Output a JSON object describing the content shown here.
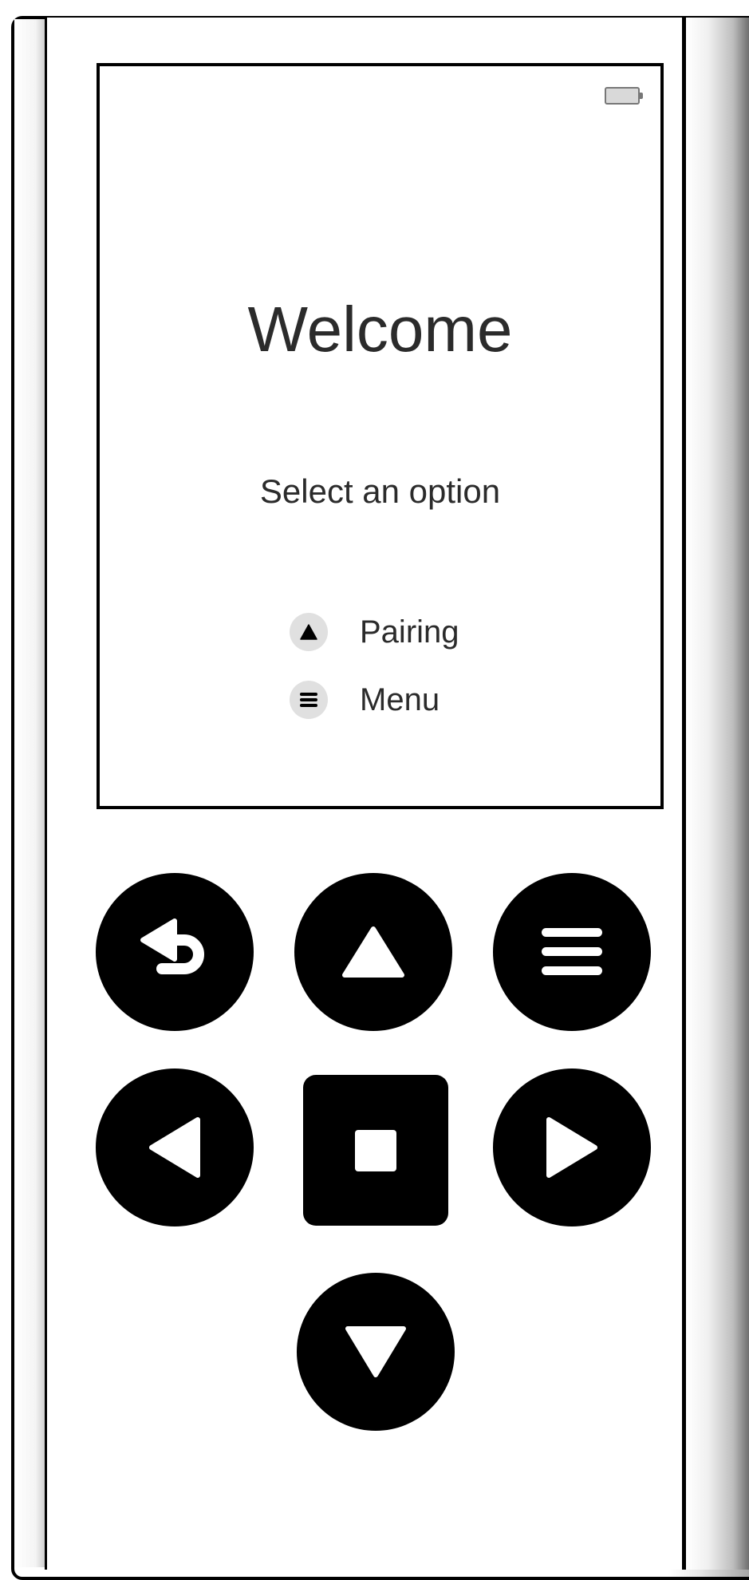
{
  "screen": {
    "title": "Welcome",
    "subtitle": "Select an option",
    "options": [
      {
        "label": "Pairing",
        "icon": "triangle-up-icon"
      },
      {
        "label": "Menu",
        "icon": "hamburger-menu-icon"
      }
    ],
    "battery_icon": "battery-icon"
  },
  "keypad": {
    "buttons": [
      {
        "name": "back-button",
        "icon": "back-arrow-icon"
      },
      {
        "name": "up-button",
        "icon": "triangle-up-icon"
      },
      {
        "name": "menu-button",
        "icon": "hamburger-menu-icon"
      },
      {
        "name": "left-button",
        "icon": "triangle-left-icon"
      },
      {
        "name": "stop-button",
        "icon": "stop-square-icon"
      },
      {
        "name": "right-button",
        "icon": "triangle-right-icon"
      },
      {
        "name": "down-button",
        "icon": "triangle-down-icon"
      }
    ]
  },
  "colors": {
    "button": "#000000",
    "text": "#2b2b2b",
    "option_circle": "#e0e0e0"
  }
}
